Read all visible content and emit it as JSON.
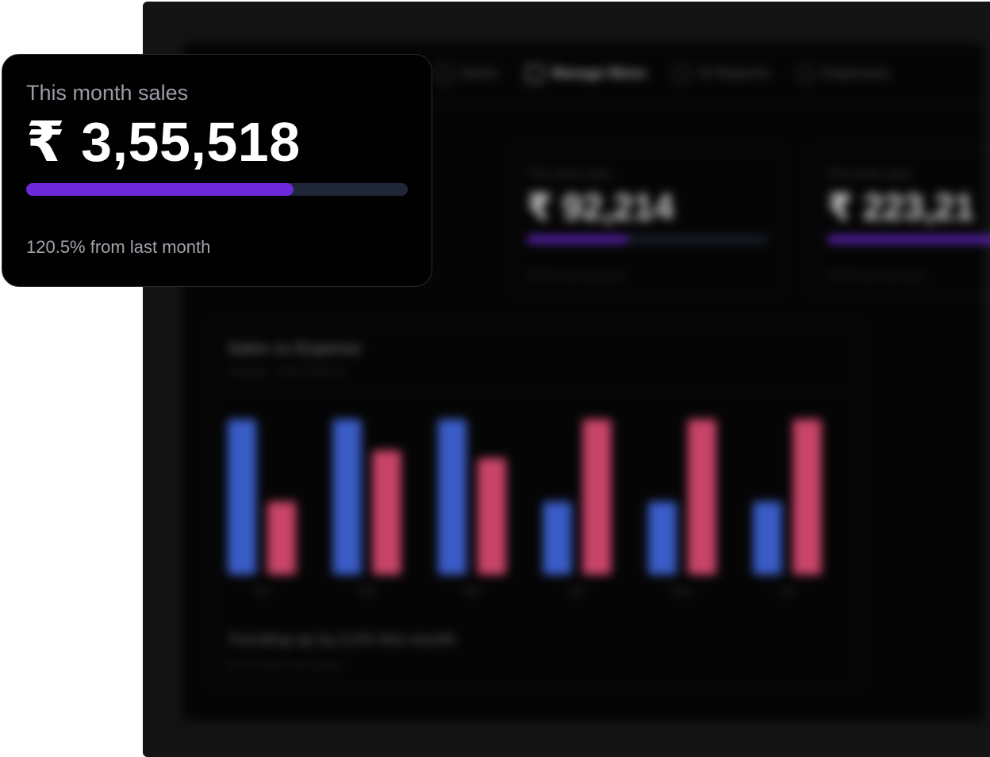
{
  "colors": {
    "accent": "#6d28d9",
    "sales_bar": "#3a5cc7",
    "expense_bar": "#c84469",
    "track": "#1f2638"
  },
  "background": {
    "nav": [
      {
        "icon": "list-icon",
        "label": "Items"
      },
      {
        "icon": "menu-grid-icon",
        "label": "Manage Menu"
      },
      {
        "icon": "chart-pie-icon",
        "label": "AI Reports"
      },
      {
        "icon": "wallet-icon",
        "label": "Expenses"
      }
    ],
    "stats": [
      {
        "label": "This week sales",
        "value": "₹ 92,214",
        "progress": 0.42,
        "sub": "50.2% from last week"
      },
      {
        "label": "This week sales",
        "value": "₹ 223,21",
        "progress": 0.9,
        "sub": "50.2% from last week"
      }
    ],
    "chart": {
      "title": "Sales vs Expense",
      "subtitle": "January - June 2024-25",
      "footer": "Trending up by 5.2% this month",
      "footnote": "50.3% above last quarter"
    }
  },
  "chart_data": {
    "type": "bar",
    "categories": [
      "Jan",
      "Feb",
      "Mar",
      "Apr",
      "May",
      "Jun"
    ],
    "series": [
      {
        "values": [
          100,
          100,
          100,
          47,
          47,
          47
        ]
      },
      {
        "values": [
          47,
          80,
          75,
          100,
          100,
          100
        ]
      }
    ],
    "ylim": [
      0,
      100
    ],
    "grid": false
  },
  "month_card": {
    "label": "This month sales",
    "value": "₹ 3,55,518",
    "progress": 0.7,
    "sub": "120.5% from last month"
  }
}
